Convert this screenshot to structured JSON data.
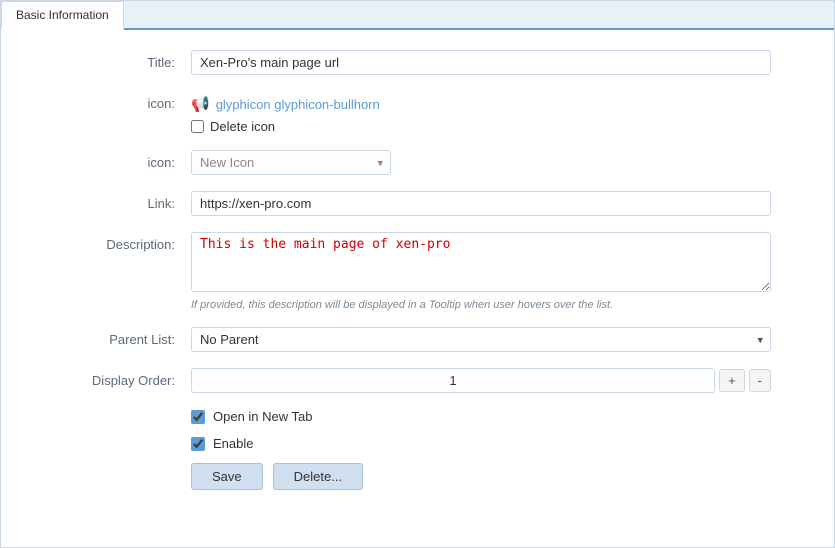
{
  "tabs": [
    {
      "id": "basic-information",
      "label": "Basic Information",
      "active": true
    }
  ],
  "form": {
    "title": {
      "label": "Title:",
      "value": "Xen-Pro's main page url"
    },
    "icon": {
      "label": "icon:",
      "current_icon_class": "glyphicon glyphicon-bullhorn",
      "delete_icon_label": "Delete icon"
    },
    "new_icon": {
      "label": "icon:",
      "placeholder": "New Icon",
      "options": [
        "New Icon"
      ]
    },
    "link": {
      "label": "Link:",
      "value": "https://xen-pro.com"
    },
    "description": {
      "label": "Description:",
      "value": "This is the main page of xen-pro",
      "hint": "If provided, this description will be displayed in a Tooltip when user hovers over the list."
    },
    "parent_list": {
      "label": "Parent List:",
      "value": "No Parent",
      "options": [
        "No Parent"
      ]
    },
    "display_order": {
      "label": "Display Order:",
      "value": "1",
      "plus_label": "+",
      "minus_label": "-"
    },
    "open_new_tab": {
      "label": "Open in New Tab",
      "checked": true
    },
    "enable": {
      "label": "Enable",
      "checked": true
    }
  },
  "buttons": {
    "save": "Save",
    "delete": "Delete..."
  }
}
